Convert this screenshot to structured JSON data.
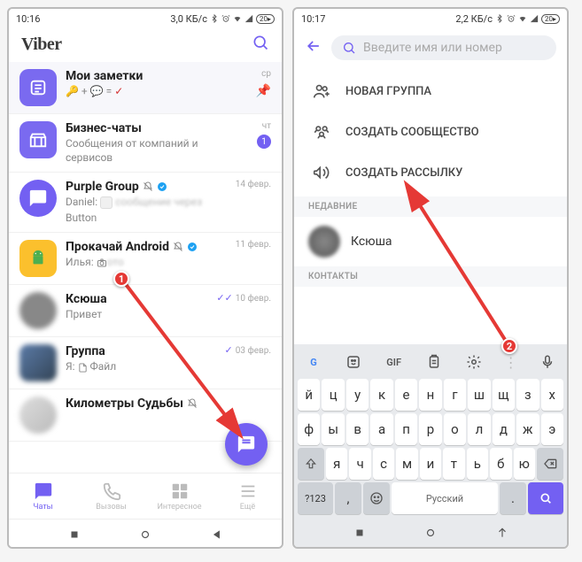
{
  "phone1": {
    "status": {
      "time": "10:16",
      "net": "3,0 КБ/с",
      "battery": "20"
    },
    "app_title": "Viber",
    "chats": [
      {
        "name": "Мои заметки",
        "sub_emoji": "🔑 + 💬 = ✔",
        "meta": "ср",
        "pinned": true,
        "avatar_bg": "#7a6af0"
      },
      {
        "name": "Бизнес-чаты",
        "sub": "Сообщения от компаний и сервисов",
        "meta": "чт",
        "badge": "1",
        "avatar_bg": "#7a6af0"
      },
      {
        "name": "Purple Group",
        "muted": true,
        "verified": true,
        "sub_prefix": "Daniel:",
        "sub_blur": "сообщение через",
        "sub2": "Button",
        "meta": "14 февр."
      },
      {
        "name": "Прокачай Android",
        "muted": true,
        "verified": true,
        "sub_prefix": "Илья:",
        "camera": true,
        "sub_blur": "ото",
        "meta": "11 февр."
      },
      {
        "name": "Ксюша",
        "sub": "Привет",
        "meta": "10 февр.",
        "checks": true
      },
      {
        "name": "Группа",
        "sub_prefix": "Я:",
        "file": true,
        "sub": "Файл",
        "meta": "03 февр.",
        "checks": true
      },
      {
        "name": "Километры Судьбы",
        "muted": true
      }
    ],
    "nav": {
      "chats": "Чаты",
      "calls": "Вызовы",
      "explore": "Интересное",
      "more": "Ещё"
    }
  },
  "phone2": {
    "status": {
      "time": "10:17",
      "net": "2,2 КБ/с",
      "battery": "20"
    },
    "search_placeholder": "Введите имя или номер",
    "options": {
      "new_group": "НОВАЯ ГРУППА",
      "new_community": "СОЗДАТЬ СООБЩЕСТВО",
      "new_broadcast": "СОЗДАТЬ РАССЫЛКУ"
    },
    "sections": {
      "recent": "НЕДАВНИЕ",
      "contacts": "КОНТАКТЫ"
    },
    "recent_contact": "Ксюша",
    "keyboard": {
      "row1": [
        "й",
        "ц",
        "у",
        "к",
        "е",
        "н",
        "г",
        "ш",
        "щ",
        "з",
        "х"
      ],
      "row2": [
        "ф",
        "ы",
        "в",
        "а",
        "п",
        "р",
        "о",
        "л",
        "д",
        "ж",
        "э"
      ],
      "row3": [
        "я",
        "ч",
        "с",
        "м",
        "и",
        "т",
        "ь",
        "б",
        "ю"
      ],
      "num_key": "?123",
      "space": "Русский",
      "gif": "GIF"
    }
  },
  "markers": {
    "m1": "1",
    "m2": "2"
  }
}
